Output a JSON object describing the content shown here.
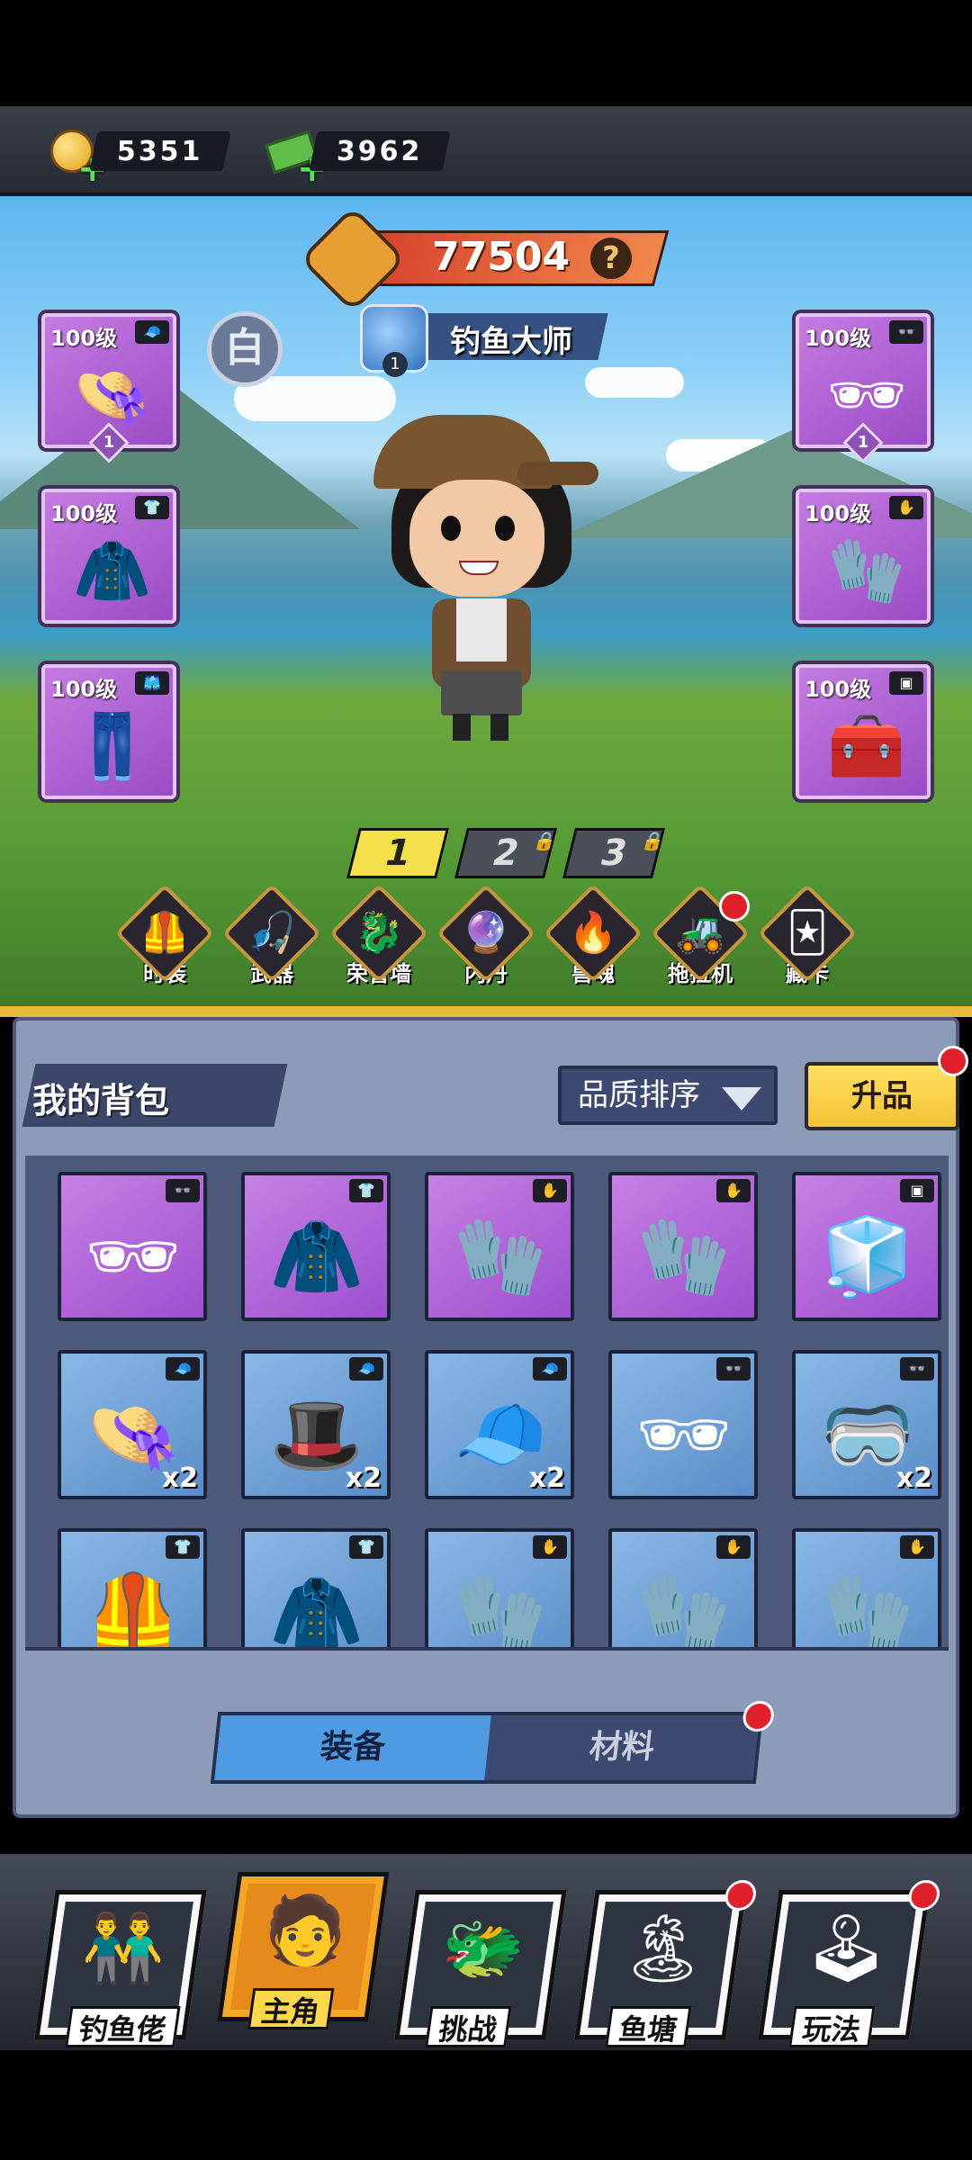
{
  "currency": {
    "gold": "5351",
    "cash": "3962"
  },
  "power": {
    "value": "77504",
    "help": "?"
  },
  "rank": {
    "title": "钓鱼大师",
    "level": "1"
  },
  "quality_badge": "白",
  "equip_left": [
    {
      "level": "100级",
      "star": "1"
    },
    {
      "level": "100级"
    },
    {
      "level": "100级"
    }
  ],
  "equip_right": [
    {
      "level": "100级",
      "star": "1"
    },
    {
      "level": "100级"
    },
    {
      "level": "100级"
    }
  ],
  "loadout_tabs": [
    "1",
    "2",
    "3"
  ],
  "feature_menu": [
    "时装",
    "武器",
    "荣誉墙",
    "内丹",
    "兽魂",
    "拖拉机",
    "藏卡"
  ],
  "bag": {
    "title": "我的背包",
    "sort_label": "品质排序",
    "upgrade_label": "升品",
    "counts": [
      "x2",
      "x2",
      "x2",
      "x2"
    ],
    "tabs": {
      "equipment": "装备",
      "material": "材料"
    }
  },
  "bottom_nav": [
    "钓鱼佬",
    "主角",
    "挑战",
    "鱼塘",
    "玩法"
  ],
  "colors": {
    "alert_dot": "#e2202a",
    "accent_yellow": "#f2c234",
    "panel": "#8e9bb8"
  }
}
